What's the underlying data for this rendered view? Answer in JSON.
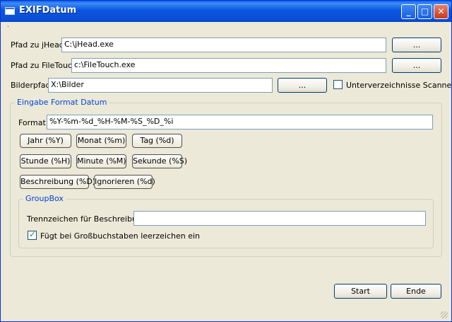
{
  "window": {
    "title": "EXIFDatum",
    "minimize_glyph": "_",
    "maximize_glyph": "□",
    "close_glyph": "✕"
  },
  "paths": {
    "jhead": {
      "label": "Pfad zu jHead",
      "value": "C:\\jHead.exe",
      "browse": "..."
    },
    "filetouch": {
      "label": "Pfad zu FileTouch",
      "value": "c:\\FileTouch.exe",
      "browse": "..."
    },
    "bilder": {
      "label": "Bilderpfad",
      "value": "X:\\Bilder",
      "browse": "..."
    },
    "subdirs": {
      "label": "Unterverzeichnisse Scannen",
      "checked": false
    }
  },
  "format_group": {
    "title": "Eingabe Format Datum",
    "format_label": "Format",
    "format_value": "%Y-%m-%d_%H-%M-%S_%D_%i",
    "tokens": {
      "jahr": "Jahr (%Y)",
      "monat": "Monat (%m)",
      "tag": "Tag (%d)",
      "stunde": "Stunde (%H)",
      "minute": "Minute (%M)",
      "sekunde": "Sekunde (%S)",
      "beschreibung": "Beschreibung (%D)",
      "ignorieren": "Ignorieren (%d)"
    },
    "groupbox": {
      "title": "GroupBox",
      "separator_label": "Trennzeichen für Beschreibung",
      "separator_value": "",
      "space_label": "Fügt bei Großbuchstaben leerzeichen ein",
      "space_checked": true
    }
  },
  "actions": {
    "start": "Start",
    "end": "Ende"
  }
}
